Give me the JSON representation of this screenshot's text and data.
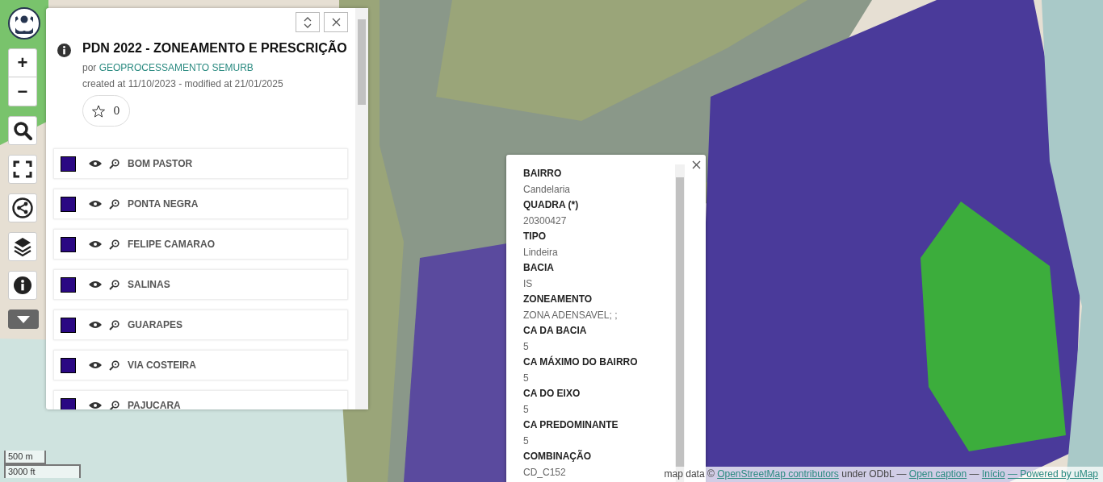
{
  "controls": [
    {
      "kind": "zoom_in",
      "label": "+"
    },
    {
      "kind": "zoom_out",
      "label": "−"
    },
    {
      "kind": "search"
    },
    {
      "kind": "fullscreen"
    },
    {
      "kind": "share"
    },
    {
      "kind": "layers"
    },
    {
      "kind": "info"
    },
    {
      "kind": "more"
    }
  ],
  "panel": {
    "title": "PDN 2022 - ZONEAMENTO E PRESCRIÇÃO",
    "author_prefix": "por",
    "author": "GEOPROCESSAMENTO SEMURB",
    "dates": "created at 11/10/2023 - modified at 21/01/2025",
    "star_count": "0",
    "layers": [
      {
        "name": "BOM PASTOR"
      },
      {
        "name": "PONTA NEGRA"
      },
      {
        "name": "FELIPE CAMARAO"
      },
      {
        "name": "SALINAS"
      },
      {
        "name": "GUARAPES"
      },
      {
        "name": "VIA COSTEIRA"
      },
      {
        "name": "PAJUCARA"
      }
    ]
  },
  "popup": {
    "fields": [
      {
        "label": "BAIRRO",
        "value": "Candelaria"
      },
      {
        "label": "QUADRA (*)",
        "value": "20300427"
      },
      {
        "label": "TIPO",
        "value": "Lindeira"
      },
      {
        "label": "BACIA",
        "value": "IS"
      },
      {
        "label": "ZONEAMENTO",
        "value": "ZONA ADENSAVEL; ;"
      },
      {
        "label": "CA DA BACIA",
        "value": "5"
      },
      {
        "label": "CA MÁXIMO DO BAIRRO",
        "value": "5"
      },
      {
        "label": "CA DO EIXO",
        "value": "5"
      },
      {
        "label": "CA PREDOMINANTE",
        "value": "5"
      },
      {
        "label": "COMBINAÇÃO",
        "value": "CD_C152"
      }
    ]
  },
  "scale": {
    "metric": "500 m",
    "imperial": "3000 ft"
  },
  "attribution": {
    "prefix": "map data ©",
    "osm_link": "OpenStreetMap contributors",
    "license": "under ODbL —",
    "caption_link": "Open caption",
    "separator": "—",
    "home_link": "Início",
    "powered_link": "— Powered by uMap"
  }
}
